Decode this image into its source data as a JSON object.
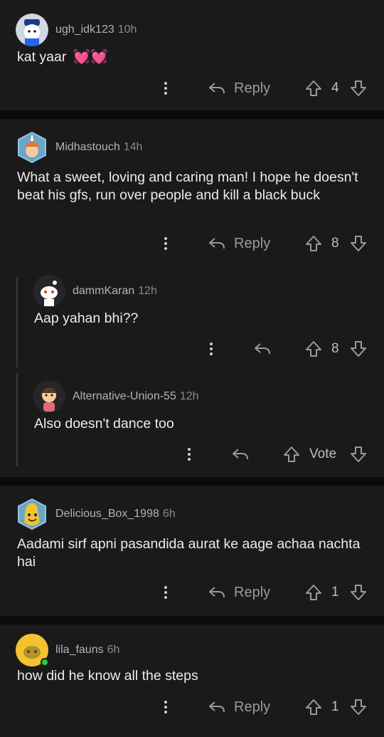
{
  "comments": [
    {
      "user": "ugh_idk123",
      "time": "10h",
      "text": "kat yaar",
      "emoji": "💓💓",
      "reply": "Reply",
      "score": "4"
    },
    {
      "user": "Midhastouch",
      "time": "14h",
      "text": "What a sweet, loving and caring man! I hope he doesn't beat his gfs, run over people and kill a black buck",
      "reply": "Reply",
      "score": "8"
    },
    {
      "user": "dammKaran",
      "time": "12h",
      "text": "Aap yahan bhi??",
      "score": "8"
    },
    {
      "user": "Alternative-Union-55",
      "time": "12h",
      "text": "Also doesn't dance too",
      "vote": "Vote"
    },
    {
      "user": "Delicious_Box_1998",
      "time": "6h",
      "text": "Aadami sirf apni pasandida aurat ke aage achaa nachta hai",
      "reply": "Reply",
      "score": "1"
    },
    {
      "user": "lila_fauns",
      "time": "6h",
      "text": "how did he know all the steps",
      "reply": "Reply",
      "score": "1"
    }
  ],
  "icons": {
    "more": "more-options-icon",
    "reply": "reply-arrow-icon",
    "upvote": "upvote-arrow-icon",
    "downvote": "downvote-arrow-icon"
  },
  "colors": {
    "background": "#0b0b0b",
    "card": "#1a1a1b",
    "online": "#2ecc40"
  }
}
